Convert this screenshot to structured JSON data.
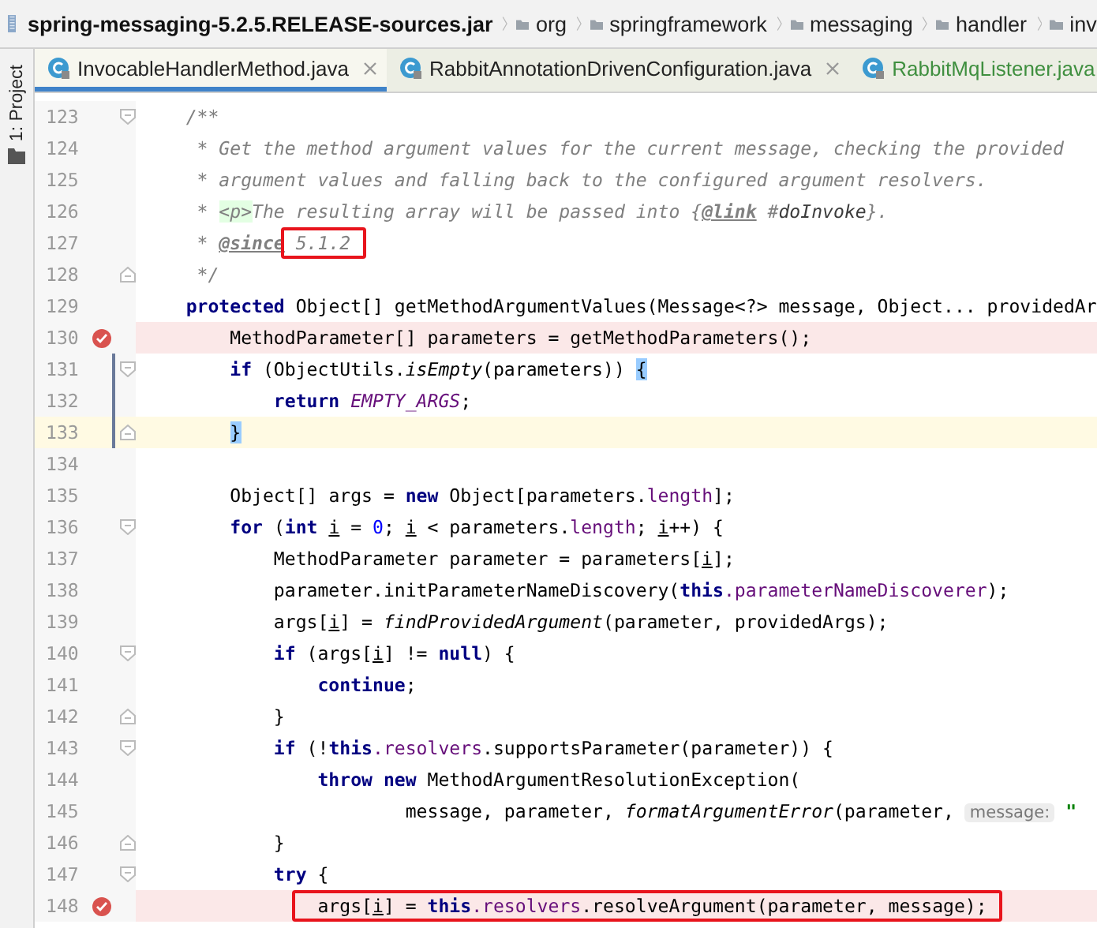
{
  "breadcrumb": {
    "jar": "spring-messaging-5.2.5.RELEASE-sources.jar",
    "folders": [
      "org",
      "springframework",
      "messaging",
      "handler",
      "inv"
    ]
  },
  "tool_window": {
    "label": "1: Project"
  },
  "tabs": [
    {
      "label": "InvocableHandlerMethod.java",
      "selected": true,
      "vcs_added": false,
      "closable": true
    },
    {
      "label": "RabbitAnnotationDrivenConfiguration.java",
      "selected": false,
      "vcs_added": false,
      "closable": true
    },
    {
      "label": "RabbitMqListener.java",
      "selected": false,
      "vcs_added": true,
      "closable": false
    }
  ],
  "lines": [
    {
      "number": "123",
      "fold_start": true,
      "tokens": [
        {
          "text": "    /**",
          "kind": "comment"
        }
      ]
    },
    {
      "number": "124",
      "tokens": [
        {
          "text": "     * Get the method argument values for the current message, checking the provided",
          "kind": "comment"
        }
      ]
    },
    {
      "number": "125",
      "tokens": [
        {
          "text": "     * argument values and falling back to the configured argument resolvers.",
          "kind": "comment"
        }
      ]
    },
    {
      "number": "126",
      "tokens": [
        {
          "text": "     * ",
          "kind": "comment"
        },
        {
          "text": "<p>",
          "kind": "html"
        },
        {
          "text": "The resulting array will be passed into {",
          "kind": "comment"
        },
        {
          "text": "@link",
          "kind": "doctag"
        },
        {
          "text": " #",
          "kind": "comment"
        },
        {
          "text": "doInvoke",
          "kind": "docref"
        },
        {
          "text": "}.",
          "kind": "comment"
        }
      ]
    },
    {
      "number": "127",
      "tokens": [
        {
          "text": "     * ",
          "kind": "comment"
        },
        {
          "text": "@since",
          "kind": "doctag"
        },
        {
          "text": " 5.1.2",
          "kind": "comment",
          "boxed": true
        }
      ]
    },
    {
      "number": "128",
      "fold_end": true,
      "tokens": [
        {
          "text": "     */",
          "kind": "comment"
        }
      ]
    },
    {
      "number": "129",
      "tokens": [
        {
          "text": "    protected",
          "kind": "keyword"
        },
        {
          "text": " Object[] getMethodArgumentValues(Message<?> message, Object... providedAr",
          "kind": "plain"
        }
      ]
    },
    {
      "number": "130",
      "breakpoint": true,
      "tokens": [
        {
          "text": "        MethodParameter[] parameters = getMethodParameters();",
          "kind": "plain"
        }
      ]
    },
    {
      "number": "131",
      "fold_start": true,
      "changed": true,
      "tokens": [
        {
          "text": "        if",
          "kind": "keyword"
        },
        {
          "text": " (ObjectUtils.",
          "kind": "plain"
        },
        {
          "text": "isEmpty",
          "kind": "static_call"
        },
        {
          "text": "(parameters)) ",
          "kind": "plain"
        },
        {
          "text": "{",
          "kind": "brace_match"
        }
      ]
    },
    {
      "number": "132",
      "changed": true,
      "tokens": [
        {
          "text": "            return",
          "kind": "keyword"
        },
        {
          "text": " EMPTY_ARGS",
          "kind": "constant"
        },
        {
          "text": ";",
          "kind": "plain"
        }
      ]
    },
    {
      "number": "133",
      "fold_end": true,
      "changed": true,
      "current": true,
      "tokens": [
        {
          "text": "        }",
          "kind": "brace_match"
        }
      ]
    },
    {
      "number": "134"
    },
    {
      "number": "135",
      "tokens": [
        {
          "text": "        Object[] args = ",
          "kind": "plain"
        },
        {
          "text": "new",
          "kind": "keyword"
        },
        {
          "text": " Object[parameters.",
          "kind": "plain"
        },
        {
          "text": "length",
          "kind": "field"
        },
        {
          "text": "];",
          "kind": "plain"
        }
      ]
    },
    {
      "number": "136",
      "fold_start": true,
      "tokens": [
        {
          "text": "        for",
          "kind": "keyword"
        },
        {
          "text": " (",
          "kind": "plain"
        },
        {
          "text": "int",
          "kind": "keyword"
        },
        {
          "text": " i",
          "kind": "reassigned"
        },
        {
          "text": " = ",
          "kind": "plain"
        },
        {
          "text": "0",
          "kind": "number"
        },
        {
          "text": "; ",
          "kind": "plain"
        },
        {
          "text": "i",
          "kind": "reassigned"
        },
        {
          "text": " < parameters.",
          "kind": "plain"
        },
        {
          "text": "length",
          "kind": "field"
        },
        {
          "text": "; ",
          "kind": "plain"
        },
        {
          "text": "i",
          "kind": "reassigned"
        },
        {
          "text": "++) {",
          "kind": "plain"
        }
      ]
    },
    {
      "number": "137",
      "tokens": [
        {
          "text": "            MethodParameter parameter = parameters[",
          "kind": "plain"
        },
        {
          "text": "i",
          "kind": "reassigned"
        },
        {
          "text": "];",
          "kind": "plain"
        }
      ]
    },
    {
      "number": "138",
      "tokens": [
        {
          "text": "            parameter.initParameterNameDiscovery(",
          "kind": "plain"
        },
        {
          "text": "this",
          "kind": "keyword"
        },
        {
          "text": ".parameterNameDiscoverer",
          "kind": "field"
        },
        {
          "text": ");",
          "kind": "plain"
        }
      ]
    },
    {
      "number": "139",
      "tokens": [
        {
          "text": "            args[",
          "kind": "plain"
        },
        {
          "text": "i",
          "kind": "reassigned"
        },
        {
          "text": "] = ",
          "kind": "plain"
        },
        {
          "text": "findProvidedArgument",
          "kind": "static_call"
        },
        {
          "text": "(parameter, providedArgs);",
          "kind": "plain"
        }
      ]
    },
    {
      "number": "140",
      "fold_start": true,
      "tokens": [
        {
          "text": "            if",
          "kind": "keyword"
        },
        {
          "text": " (args[",
          "kind": "plain"
        },
        {
          "text": "i",
          "kind": "reassigned"
        },
        {
          "text": "] != ",
          "kind": "plain"
        },
        {
          "text": "null",
          "kind": "keyword"
        },
        {
          "text": ") {",
          "kind": "plain"
        }
      ]
    },
    {
      "number": "141",
      "tokens": [
        {
          "text": "                continue",
          "kind": "keyword"
        },
        {
          "text": ";",
          "kind": "plain"
        }
      ]
    },
    {
      "number": "142",
      "fold_end": true,
      "tokens": [
        {
          "text": "            }",
          "kind": "plain"
        }
      ]
    },
    {
      "number": "143",
      "fold_start": true,
      "tokens": [
        {
          "text": "            if",
          "kind": "keyword"
        },
        {
          "text": " (!",
          "kind": "plain"
        },
        {
          "text": "this",
          "kind": "keyword"
        },
        {
          "text": ".resolvers",
          "kind": "field"
        },
        {
          "text": ".supportsParameter(parameter)) {",
          "kind": "plain"
        }
      ]
    },
    {
      "number": "144",
      "tokens": [
        {
          "text": "                throw",
          "kind": "keyword"
        },
        {
          "text": " new",
          "kind": "keyword"
        },
        {
          "text": " MethodArgumentResolutionException(",
          "kind": "plain"
        }
      ]
    },
    {
      "number": "145",
      "tokens": [
        {
          "text": "                        message, parameter, ",
          "kind": "plain"
        },
        {
          "text": "formatArgumentError",
          "kind": "static_call"
        },
        {
          "text": "(parameter, ",
          "kind": "plain"
        },
        {
          "text": "message:",
          "kind": "param_hint"
        },
        {
          "text": " \"",
          "kind": "string"
        }
      ]
    },
    {
      "number": "146",
      "fold_end": true,
      "tokens": [
        {
          "text": "            }",
          "kind": "plain"
        }
      ]
    },
    {
      "number": "147",
      "fold_start": true,
      "tokens": [
        {
          "text": "            try",
          "kind": "keyword"
        },
        {
          "text": " {",
          "kind": "plain"
        }
      ]
    },
    {
      "number": "148",
      "breakpoint": true,
      "tokens": [
        {
          "text": "                args[",
          "kind": "plain",
          "boxed": true
        },
        {
          "text": "i",
          "kind": "reassigned",
          "boxed": true
        },
        {
          "text": "] = ",
          "kind": "plain",
          "boxed": true
        },
        {
          "text": "this",
          "kind": "keyword",
          "boxed": true
        },
        {
          "text": ".resolvers",
          "kind": "field",
          "boxed": true
        },
        {
          "text": ".resolveArgument(parameter, message);",
          "kind": "plain",
          "boxed": true
        }
      ]
    }
  ]
}
